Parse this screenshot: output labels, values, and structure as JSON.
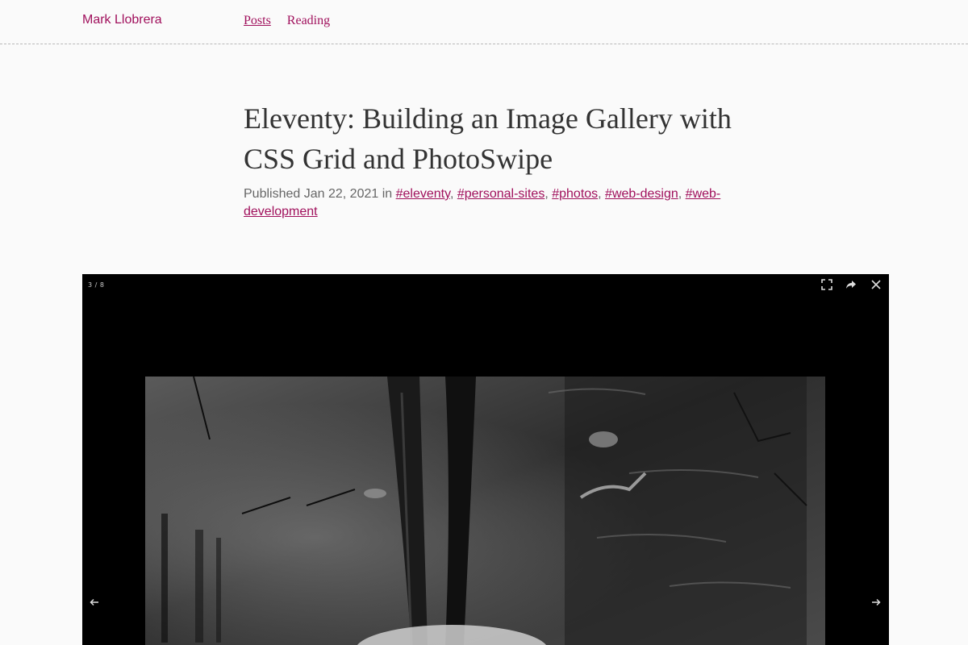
{
  "header": {
    "site_title": "Mark Llobrera",
    "nav": [
      {
        "label": "Posts"
      },
      {
        "label": "Reading"
      }
    ]
  },
  "post": {
    "title": "Eleventy: Building an Image Gallery with CSS Grid and PhotoSwipe",
    "published_prefix": "Published",
    "date": "Jan 22, 2021",
    "in_word": "in",
    "tags": [
      "#eleventy",
      "#personal-sites",
      "#photos",
      "#web-design",
      "#web-development"
    ]
  },
  "gallery": {
    "counter": "3 / 8",
    "icons": {
      "fullscreen": "fullscreen-icon",
      "share": "share-icon",
      "close": "close-icon",
      "prev": "arrow-left-icon",
      "next": "arrow-right-icon"
    },
    "photo_description_icon": "photo"
  },
  "colors": {
    "accent": "#a0105c",
    "background": "#fafafa",
    "text": "#333333",
    "meta": "#666666",
    "viewer_bg": "#000000"
  }
}
